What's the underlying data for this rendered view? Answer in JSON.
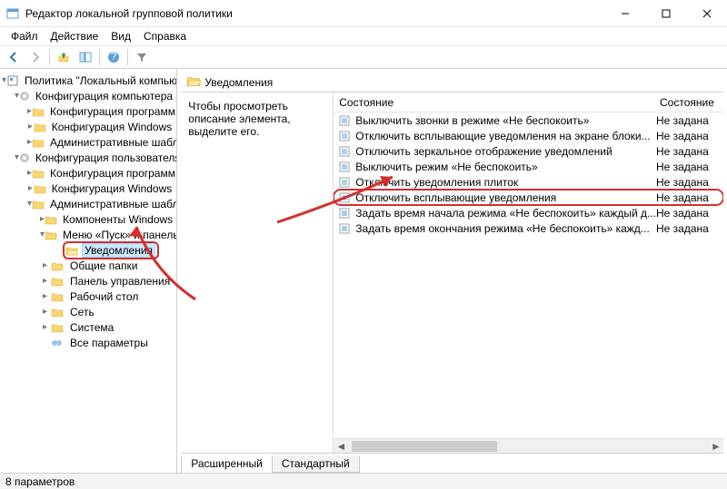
{
  "window": {
    "title": "Редактор локальной групповой политики"
  },
  "menu": {
    "file": "Файл",
    "action": "Действие",
    "view": "Вид",
    "help": "Справка"
  },
  "tree": {
    "root": "Политика \"Локальный компьютер\"",
    "compCfg": "Конфигурация компьютера",
    "compCfgChildren": {
      "progs": "Конфигурация программ",
      "win": "Конфигурация Windows",
      "admin": "Административные шаблоны"
    },
    "userCfg": "Конфигурация пользователя",
    "userCfgChildren": {
      "progs": "Конфигурация программ",
      "win": "Конфигурация Windows",
      "admin": "Административные шаблоны",
      "adminChildren": {
        "winComp": "Компоненты Windows",
        "startTask": "Меню «Пуск» и панель задач",
        "notifications": "Уведомления",
        "shared": "Общие папки",
        "ctrl": "Панель управления",
        "desktop": "Рабочий стол",
        "net": "Сеть",
        "system": "Система",
        "allSettings": "Все параметры"
      }
    }
  },
  "panel": {
    "header": "Уведомления",
    "desc": "Чтобы просмотреть описание элемента, выделите его.",
    "col_name": "Состояние",
    "col_state": "Состояние",
    "rows": [
      {
        "name": "Выключить звонки в режиме «Не беспокоить»",
        "state": "Не задана"
      },
      {
        "name": "Отключить всплывающие уведомления на экране блоки...",
        "state": "Не задана"
      },
      {
        "name": "Отключить зеркальное отображение уведомлений",
        "state": "Не задана"
      },
      {
        "name": "Выключить режим «Не беспокоить»",
        "state": "Не задана"
      },
      {
        "name": "Отключить уведомления плиток",
        "state": "Не задана"
      },
      {
        "name": "Отключить всплывающие уведомления",
        "state": "Не задана"
      },
      {
        "name": "Задать время начала режима «Не беспокоить» каждый д...",
        "state": "Не задана"
      },
      {
        "name": "Задать время окончания режима «Не беспокоить» кажд...",
        "state": "Не задана"
      }
    ],
    "tabs": {
      "ext": "Расширенный",
      "std": "Стандартный"
    }
  },
  "status": "8 параметров"
}
